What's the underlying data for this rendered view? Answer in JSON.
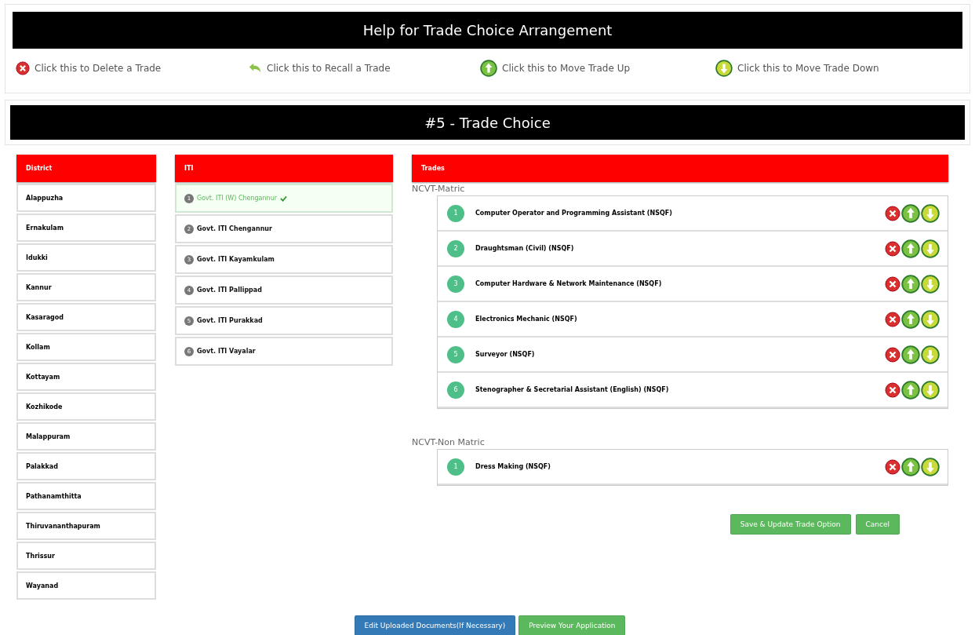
{
  "help": {
    "title": "Help for Trade Choice Arrangement",
    "legend": [
      {
        "kind": "delete",
        "text": "Click this to Delete a Trade"
      },
      {
        "kind": "recall",
        "text": "Click this to Recall a Trade"
      },
      {
        "kind": "up",
        "text": "Click this to Move Trade Up"
      },
      {
        "kind": "down",
        "text": "Click this to Move Trade Down"
      }
    ]
  },
  "section_title": "#5 - Trade Choice",
  "district": {
    "header": "District",
    "items": [
      {
        "label": "Alappuzha",
        "selected": false
      },
      {
        "label": "Ernakulam",
        "selected": false
      },
      {
        "label": "Idukki",
        "selected": false
      },
      {
        "label": "Kannur",
        "selected": false
      },
      {
        "label": "Kasaragod",
        "selected": false
      },
      {
        "label": "Kollam",
        "selected": false
      },
      {
        "label": "Kottayam",
        "selected": false
      },
      {
        "label": "Kozhikode",
        "selected": false
      },
      {
        "label": "Malappuram",
        "selected": false
      },
      {
        "label": "Palakkad",
        "selected": false
      },
      {
        "label": "Pathanamthitta",
        "selected": false
      },
      {
        "label": "Thiruvananthapuram",
        "selected": false
      },
      {
        "label": "Thrissur",
        "selected": false
      },
      {
        "label": "Wayanad",
        "selected": false
      }
    ]
  },
  "iti": {
    "header": "ITI",
    "items": [
      {
        "number": "1",
        "label": "Govt. ITI (W) Chengannur",
        "selected": true
      },
      {
        "number": "2",
        "label": "Govt. ITI Chengannur",
        "selected": false
      },
      {
        "number": "3",
        "label": "Govt. ITI Kayamkulam",
        "selected": false
      },
      {
        "number": "4",
        "label": "Govt. ITI Pallippad",
        "selected": false
      },
      {
        "number": "5",
        "label": "Govt. ITI Purakkad",
        "selected": false
      },
      {
        "number": "6",
        "label": "Govt. ITI Vayalar",
        "selected": false
      }
    ]
  },
  "trades": {
    "header": "Trades",
    "groups": [
      {
        "title": "NCVT-Matric",
        "items": [
          {
            "number": "1",
            "label": "Computer Operator and Programming Assistant (NSQF)"
          },
          {
            "number": "2",
            "label": "Draughtsman (Civil) (NSQF)"
          },
          {
            "number": "3",
            "label": "Computer Hardware & Network Maintenance (NSQF)"
          },
          {
            "number": "4",
            "label": "Electronics Mechanic (NSQF)"
          },
          {
            "number": "5",
            "label": "Surveyor (NSQF)"
          },
          {
            "number": "6",
            "label": "Stenographer & Secretarial Assistant (English) (NSQF)"
          }
        ]
      },
      {
        "title": "NCVT-Non Matric",
        "items": [
          {
            "number": "1",
            "label": "Dress Making (NSQF)"
          }
        ]
      }
    ]
  },
  "actions": [
    "Save & Update Trade Option",
    "Cancel"
  ],
  "footer_buttons": [
    {
      "kind": "primary",
      "label": "Edit Uploaded Documents(If Necessary)"
    },
    {
      "kind": "success",
      "label": "Preview Your Application"
    }
  ]
}
